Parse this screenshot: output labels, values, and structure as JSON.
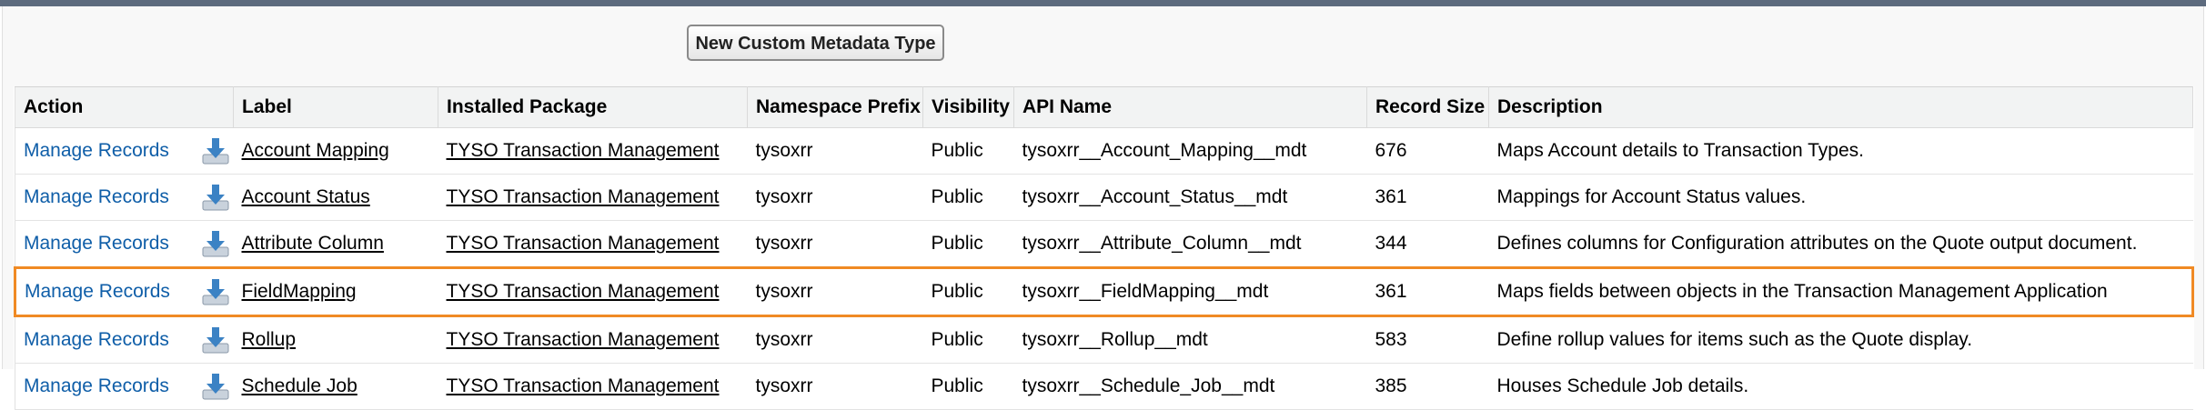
{
  "toolbar": {
    "new_button_label": "New Custom Metadata Type"
  },
  "table": {
    "columns": [
      "Action",
      "Label",
      "Installed Package",
      "Namespace Prefix",
      "Visibility",
      "API Name",
      "Record Size",
      "Description"
    ],
    "rows": [
      {
        "action": "Manage Records",
        "label": "Account Mapping",
        "package": "TYSO Transaction Management",
        "prefix": "tysoxrr",
        "visibility": "Public",
        "api": "tysoxrr__Account_Mapping__mdt",
        "size": "676",
        "desc": "Maps Account details to Transaction Types."
      },
      {
        "action": "Manage Records",
        "label": "Account Status",
        "package": "TYSO Transaction Management",
        "prefix": "tysoxrr",
        "visibility": "Public",
        "api": "tysoxrr__Account_Status__mdt",
        "size": "361",
        "desc": "Mappings for Account Status values."
      },
      {
        "action": "Manage Records",
        "label": "Attribute Column",
        "package": "TYSO Transaction Management",
        "prefix": "tysoxrr",
        "visibility": "Public",
        "api": "tysoxrr__Attribute_Column__mdt",
        "size": "344",
        "desc": "Defines columns for Configuration attributes on the Quote output document."
      },
      {
        "action": "Manage Records",
        "label": "FieldMapping",
        "package": "TYSO Transaction Management",
        "prefix": "tysoxrr",
        "visibility": "Public",
        "api": "tysoxrr__FieldMapping__mdt",
        "size": "361",
        "desc": "Maps fields between objects in the Transaction Management Application"
      },
      {
        "action": "Manage Records",
        "label": "Rollup",
        "package": "TYSO Transaction Management",
        "prefix": "tysoxrr",
        "visibility": "Public",
        "api": "tysoxrr__Rollup__mdt",
        "size": "583",
        "desc": "Define rollup values for items such as the Quote display."
      },
      {
        "action": "Manage Records",
        "label": "Schedule Job",
        "package": "TYSO Transaction Management",
        "prefix": "tysoxrr",
        "visibility": "Public",
        "api": "tysoxrr__Schedule_Job__mdt",
        "size": "385",
        "desc": "Houses Schedule Job details."
      }
    ]
  },
  "icons": {
    "download": "download-arrow-icon"
  },
  "colors": {
    "link": "#0f5ea8",
    "highlight": "#f08a24",
    "header_bg": "#f2f3f3",
    "top_bar": "#5d6b7e"
  }
}
